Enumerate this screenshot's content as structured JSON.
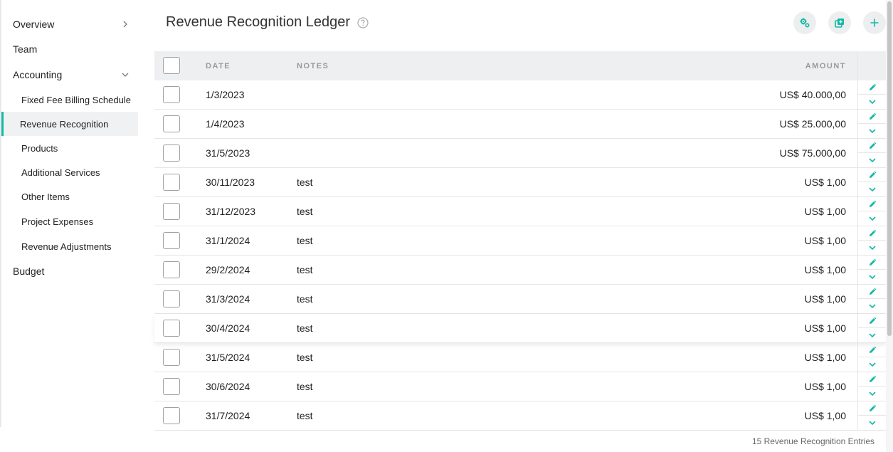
{
  "sidebar": {
    "top_items": [
      {
        "label": "Overview"
      },
      {
        "label": "Team"
      },
      {
        "label": "Accounting"
      },
      {
        "label": "Budget"
      }
    ],
    "accounting_children": [
      {
        "label": "Fixed Fee Billing Schedule"
      },
      {
        "label": "Revenue Recognition"
      },
      {
        "label": "Products"
      },
      {
        "label": "Additional Services"
      },
      {
        "label": "Other Items"
      },
      {
        "label": "Project Expenses"
      },
      {
        "label": "Revenue Adjustments"
      }
    ]
  },
  "header": {
    "title": "Revenue Recognition Ledger",
    "help_icon": "question-circle-icon",
    "toolbar": [
      "settings-cogs-icon",
      "duplicate-icon",
      "add-icon"
    ]
  },
  "table": {
    "columns": {
      "date": "DATE",
      "notes": "NOTES",
      "amount": "AMOUNT"
    },
    "rows": [
      {
        "date": "1/3/2023",
        "notes": "",
        "amount": "US$ 40.000,00"
      },
      {
        "date": "1/4/2023",
        "notes": "",
        "amount": "US$ 25.000,00"
      },
      {
        "date": "31/5/2023",
        "notes": "",
        "amount": "US$ 75.000,00"
      },
      {
        "date": "30/11/2023",
        "notes": "test",
        "amount": "US$ 1,00"
      },
      {
        "date": "31/12/2023",
        "notes": "test",
        "amount": "US$ 1,00"
      },
      {
        "date": "31/1/2024",
        "notes": "test",
        "amount": "US$ 1,00"
      },
      {
        "date": "29/2/2024",
        "notes": "test",
        "amount": "US$ 1,00"
      },
      {
        "date": "31/3/2024",
        "notes": "test",
        "amount": "US$ 1,00"
      },
      {
        "date": "30/4/2024",
        "notes": "test",
        "amount": "US$ 1,00"
      },
      {
        "date": "31/5/2024",
        "notes": "test",
        "amount": "US$ 1,00"
      },
      {
        "date": "30/6/2024",
        "notes": "test",
        "amount": "US$ 1,00"
      },
      {
        "date": "31/7/2024",
        "notes": "test",
        "amount": "US$ 1,00"
      }
    ]
  },
  "footer": {
    "count_text": "15 Revenue Recognition Entries"
  },
  "colors": {
    "accent": "#14b8a6",
    "header_bg": "#eeeff0",
    "active_bg": "#f0f1f2"
  }
}
